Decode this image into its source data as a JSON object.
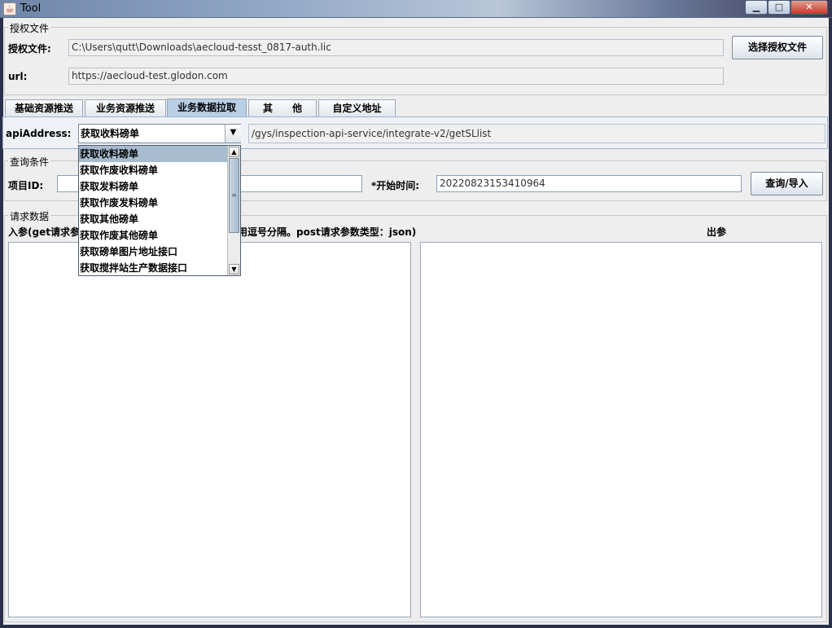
{
  "window": {
    "title": "Tool",
    "app_icon": "java-cup-icon"
  },
  "auth": {
    "group_title": "授权文件",
    "file_label": "授权文件:",
    "file_value": "C:\\Users\\qutt\\Downloads\\aecloud-tesst_0817-auth.lic",
    "select_button": "选择授权文件",
    "url_label": "url:",
    "url_value": "https://aecloud-test.glodon.com"
  },
  "tabs": [
    {
      "label": "基础资源推送"
    },
    {
      "label": "业务资源推送"
    },
    {
      "label": "业务数据拉取"
    },
    {
      "label": "其　　他"
    },
    {
      "label": "自定义地址"
    }
  ],
  "active_tab": 2,
  "api": {
    "label": "apiAddress:",
    "selected": "获取收料磅单",
    "path": "/gys/inspection-api-service/integrate-v2/getSLlist"
  },
  "dropdown": {
    "options": [
      "获取收料磅单",
      "获取作废收料磅单",
      "获取发料磅单",
      "获取作废发料磅单",
      "获取其他磅单",
      "获取作废其他磅单",
      "获取磅单图片地址接口",
      "获取搅拌站生产数据接口"
    ],
    "selected_index": 0
  },
  "query": {
    "group_title": "查询条件",
    "project_label": "项目ID:",
    "project_value": "",
    "start_label": "*开始时间:",
    "start_value": "20220823153410964",
    "button": "查询/导入"
  },
  "request": {
    "group_title": "请求数据",
    "input_label_left": "入参(get请求参",
    "input_label_right": "用逗号分隔。post请求参数类型：json)",
    "output_label": "出参"
  }
}
